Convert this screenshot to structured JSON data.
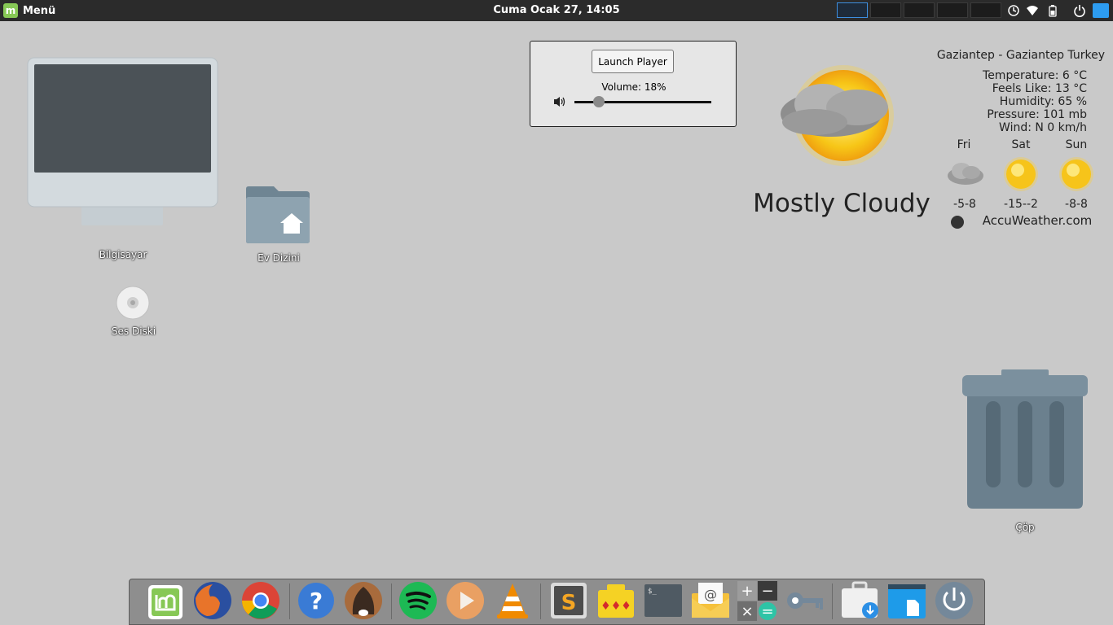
{
  "top_panel": {
    "menu_label": "Menü",
    "clock": "Cuma Ocak 27, 14:05",
    "workspaces": 5,
    "active_workspace": 1
  },
  "desktop_icons": {
    "computer_label": "Bilgisayar",
    "home_label": "Ev Dizini",
    "audio_disc_label": "Ses Diski",
    "trash_label": "Çöp"
  },
  "player": {
    "launch_label": "Launch Player",
    "volume_text": "Volume: 18%",
    "volume_fraction": 0.18
  },
  "weather": {
    "location": "Gaziantep - Gaziantep Turkey",
    "temperature": "Temperature: 6 °C",
    "feels_like": "Feels Like: 13 °C",
    "humidity": "Humidity: 65 %",
    "pressure": "Pressure: 101 mb",
    "wind": "Wind: N 0 km/h",
    "condition": "Mostly Cloudy",
    "provider": "AccuWeather.com",
    "forecast": [
      {
        "day": "Fri",
        "temps": "-5-8",
        "icon": "cloudy-icon"
      },
      {
        "day": "Sat",
        "temps": "-15--2",
        "icon": "sun-icon"
      },
      {
        "day": "Sun",
        "temps": "-8-8",
        "icon": "sun-icon"
      }
    ]
  },
  "colors": {
    "panel": "#2b2b2b",
    "desktop": "#c9c9c9",
    "accent": "#3d8fe0",
    "mint": "#87c856"
  },
  "dock_items": [
    "mint-menu-icon",
    "firefox-icon",
    "chrome-icon",
    "help-icon",
    "tor-browser-icon",
    "spotify-icon",
    "media-player-icon",
    "vlc-icon",
    "sublime-text-icon",
    "package-icon",
    "terminal-icon",
    "mail-icon",
    "calculator-icon",
    "key-icon",
    "software-install-icon",
    "files-icon",
    "power-icon"
  ]
}
